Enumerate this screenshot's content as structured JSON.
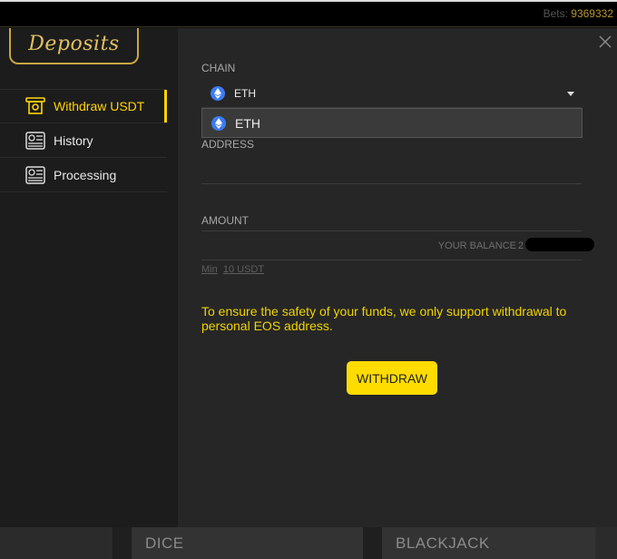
{
  "topbar": {
    "bets_label": "Bets:",
    "bets_value": "9369332"
  },
  "logo": {
    "text": "Deposits"
  },
  "nav": {
    "items": [
      {
        "label": "Withdraw USDT",
        "icon": "withdraw-icon",
        "active": true
      },
      {
        "label": "History",
        "icon": "history-icon",
        "active": false
      },
      {
        "label": "Processing",
        "icon": "processing-icon",
        "active": false
      }
    ]
  },
  "form": {
    "chain_label": "CHAIN",
    "chain_value": "ETH",
    "dropdown_options": [
      "ETH"
    ],
    "address_label": "ADDRESS",
    "address_value": "",
    "amount_label": "AMOUNT",
    "amount_value": "",
    "balance_label": "YOUR BALANCE",
    "balance_value": "2",
    "min_label": "Min",
    "min_value": "10 USDT",
    "notice": "To ensure the safety of your funds, we only support withdrawal to personal EOS address.",
    "withdraw_button": "WITHDRAW"
  },
  "bottom_tabs": [
    "DICE",
    "BLACKJACK"
  ],
  "colors": {
    "accent": "#ffd400",
    "gold": "#c9a640",
    "eth": "#3c7bf0"
  }
}
